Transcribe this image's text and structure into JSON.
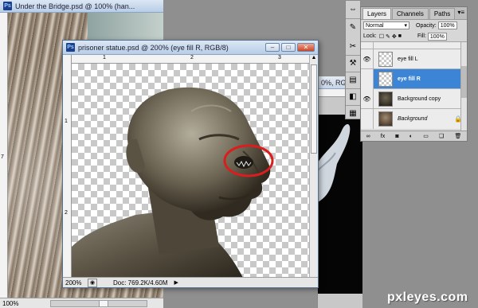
{
  "background_window": {
    "title": "Under the Bridge.psd @ 100% (han...",
    "zoom": "100%",
    "ruler_tick": "7"
  },
  "main_window": {
    "title": "prisoner statue.psd @ 200% (eye fill R, RGB/8)",
    "zoom": "200%",
    "doc_info": "Doc: 769.2K/4.60M",
    "ruler_ticks_top": [
      "1",
      "2",
      "3"
    ],
    "ruler_ticks_left": [
      "1",
      "2"
    ]
  },
  "right_window": {
    "title_fragment": "0%, RG..."
  },
  "layers_panel": {
    "tabs": [
      "Layers",
      "Channels",
      "Paths"
    ],
    "blend_mode": "Normal",
    "opacity_label": "Opacity:",
    "opacity_value": "100%",
    "lock_label": "Lock:",
    "fill_label": "Fill:",
    "fill_value": "100%",
    "layers": [
      {
        "name": "eye fill L",
        "selected": false
      },
      {
        "name": "eye fill R",
        "selected": true
      },
      {
        "name": "Background copy",
        "selected": false
      },
      {
        "name": "Background",
        "selected": false
      }
    ],
    "bottom_icons": [
      "link-icon",
      "fx-icon",
      "mask-icon",
      "adjustment-icon",
      "folder-icon",
      "new-layer-icon",
      "trash-icon"
    ]
  },
  "watermark": "pxleyes.com",
  "colors": {
    "selection": "#3b84d6",
    "annotation_circle": "#d91e1e"
  }
}
